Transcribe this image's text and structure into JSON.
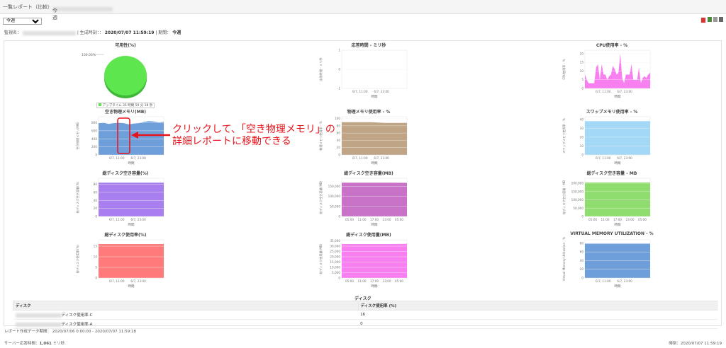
{
  "header": {
    "title": "一覧レポート（比較）",
    "separator": "-",
    "period": "今週"
  },
  "period_select": {
    "value": "今週"
  },
  "export_icons": [
    "pdf-icon",
    "csv-icon",
    "mail-icon",
    "print-icon"
  ],
  "info": {
    "monitor_label": "監視名：",
    "generated_label": "| 生成時刻：：",
    "generated": "2020/07/07 11:59:19",
    "period_label": "| 期間：",
    "period": "今週"
  },
  "annotation": {
    "line1": "クリックして、「空き物理メモリ」の",
    "line2": "詳細レポートに移動できる",
    "color": "#e8141c"
  },
  "charts": [
    {
      "title": "可用性(%)",
      "type": "pie",
      "slice_label": "100.00%",
      "legend": "アップタイム 35 時間 59 分 18 秒",
      "color": "#5de64e"
    },
    {
      "title": "応答時間 - ミリ秒",
      "type": "area",
      "ylabel": "応答時間 - ミリ秒",
      "yticks": [
        "1",
        "0",
        "-1"
      ],
      "ylim": [
        -1,
        1
      ],
      "xticks": [
        "6/7, 11:00",
        "6/7, 23:00"
      ],
      "xlabel": "時間",
      "values": [],
      "color": "#ccc"
    },
    {
      "title": "CPU使用率 - %",
      "type": "area",
      "ylabel": "CPU使用率 - %",
      "yticks": [
        "20",
        "15",
        "10",
        "5",
        "0"
      ],
      "ylim": [
        0,
        22
      ],
      "xticks": [
        "6/7, 11:00",
        "6/7, 23:00"
      ],
      "xlabel": "時間",
      "values": [
        8,
        5,
        3,
        3,
        3,
        3,
        12,
        14,
        5,
        14,
        8,
        8,
        5,
        7,
        8,
        13,
        11,
        8,
        9,
        20,
        6,
        3,
        8,
        8,
        8,
        14,
        5,
        5,
        5,
        12,
        3,
        6,
        7,
        6,
        8,
        9
      ],
      "color": "#f77ff0"
    },
    {
      "title": "空き物理メモリ(MB)",
      "type": "area",
      "ylabel": "空き物理メモリ(MB)",
      "yticks": [
        "800",
        "600",
        "400",
        "200",
        "0"
      ],
      "ylim": [
        0,
        950
      ],
      "xticks": [
        "6/7, 11:00",
        "6/7, 23:00"
      ],
      "xlabel": "時間",
      "values": [
        790,
        800,
        770,
        790,
        800,
        790,
        760,
        780,
        790,
        820,
        840,
        830,
        810,
        820
      ],
      "color": "#6f9fda"
    },
    {
      "title": "物理メモリ使用率 - %",
      "type": "area",
      "ylabel": "物理メモリ使用率 - %",
      "yticks": [
        "100",
        "80",
        "60",
        "40",
        "20",
        "0"
      ],
      "ylim": [
        0,
        105
      ],
      "xticks": [
        "6/7, 11:00",
        "6/7, 23:00"
      ],
      "xlabel": "時間",
      "values": [
        90,
        90,
        90,
        90,
        90,
        89,
        88,
        88,
        88,
        88
      ],
      "color": "#bfa585"
    },
    {
      "title": "スワップメモリ使用率 - %",
      "type": "area",
      "ylabel": "スワップメモリ使用率 - %",
      "yticks": [
        "40",
        "30",
        "20",
        "10",
        "0"
      ],
      "ylim": [
        0,
        43
      ],
      "xticks": [
        "6/7, 11:00",
        "6/7, 23:00"
      ],
      "xlabel": "時間",
      "values": [
        38,
        38,
        38,
        38,
        38
      ],
      "color": "#a3d9f7"
    },
    {
      "title": "総ディスク空き容量(%)",
      "type": "area",
      "ylabel": "総ディスク空き容量(%)",
      "yticks": [
        "80",
        "60",
        "40",
        "20",
        "0"
      ],
      "ylim": [
        0,
        95
      ],
      "xticks": [
        "6/7, 11:00",
        "6/7, 23:00"
      ],
      "xlabel": "時間",
      "values": [
        84,
        84,
        84,
        84
      ],
      "color": "#a97fef"
    },
    {
      "title": "総ディスク空き容量(MB)",
      "type": "area",
      "ylabel": "総ディスク空き容量(MB)",
      "yticks": [
        "150,000",
        "100,000",
        "50,000",
        "0"
      ],
      "ylim": [
        0,
        190000
      ],
      "xticks": [
        "05:00",
        "11:00",
        "17:00",
        "23:00",
        "05:00"
      ],
      "xlabel": "時間",
      "values": [
        168000,
        168000,
        168000,
        168000,
        167000
      ],
      "color": "#c873c8"
    },
    {
      "title": "総ディスク空き容量 - MB",
      "type": "area",
      "ylabel": "総ディスク空き容量 - MB",
      "yticks": [
        "200,000",
        "150,000",
        "100,000",
        "50,000",
        "0"
      ],
      "ylim": [
        0,
        230000
      ],
      "xticks": [
        "05:00",
        "11:00",
        "17:00",
        "23:00",
        "05:00"
      ],
      "xlabel": "時間",
      "values": [
        205000,
        205000,
        205000,
        205000
      ],
      "color": "#8fdd6e"
    },
    {
      "title": "総ディスク使用率(%)",
      "type": "area",
      "ylabel": "総ディスク使用率(%)",
      "yticks": [
        "15",
        "10",
        "5",
        "0"
      ],
      "ylim": [
        0,
        18
      ],
      "xticks": [
        "6/7, 11:00",
        "6/7, 23:00"
      ],
      "xlabel": "時間",
      "values": [
        16,
        16,
        16,
        16
      ],
      "color": "#ff7a7a"
    },
    {
      "title": "総ディスク使用量(MB)",
      "type": "area",
      "ylabel": "総ディスク使用量(MB)",
      "yticks": [
        "35,000",
        "30,000",
        "25,000",
        "20,000",
        "15,000",
        "10,000",
        "5,000",
        "0"
      ],
      "ylim": [
        0,
        36000
      ],
      "xticks": [
        "05:00",
        "11:00",
        "17:00",
        "23:00",
        "05:00"
      ],
      "xlabel": "時間",
      "values": [
        32000,
        32000,
        32000,
        32000,
        32200
      ],
      "color": "#f77ff0"
    },
    {
      "title": "VIRTUAL MEMORY UTILIZATION - %",
      "type": "area",
      "ylabel": "Virtual Memory Utilization - %",
      "yticks": [
        "80",
        "60",
        "40",
        "20",
        "0"
      ],
      "ylim": [
        0,
        88
      ],
      "xticks": [
        "6/7, 11:00",
        "6/7, 23:00"
      ],
      "xlabel": "時間",
      "values": [
        79,
        79,
        79,
        79
      ],
      "color": "#6f9fda"
    }
  ],
  "disk_table": {
    "title": "ディスク",
    "headers": [
      "ディスク",
      "ディスク使用率 (%)"
    ],
    "rows": [
      [
        "ディスク使用率-C",
        "16"
      ],
      [
        "ディスク使用率-A",
        "0"
      ]
    ]
  },
  "footer": {
    "range_label": "レポート作成データ期間：",
    "range": "2020/07/06 0:00:00 - 2020/07/07 11:59:18",
    "server_label": "サーバー応答時間：",
    "server_value": "1,061",
    "server_unit": "ミリ秒.",
    "time_label": "時刻：",
    "time": "2020/07/07 11:59:19"
  }
}
